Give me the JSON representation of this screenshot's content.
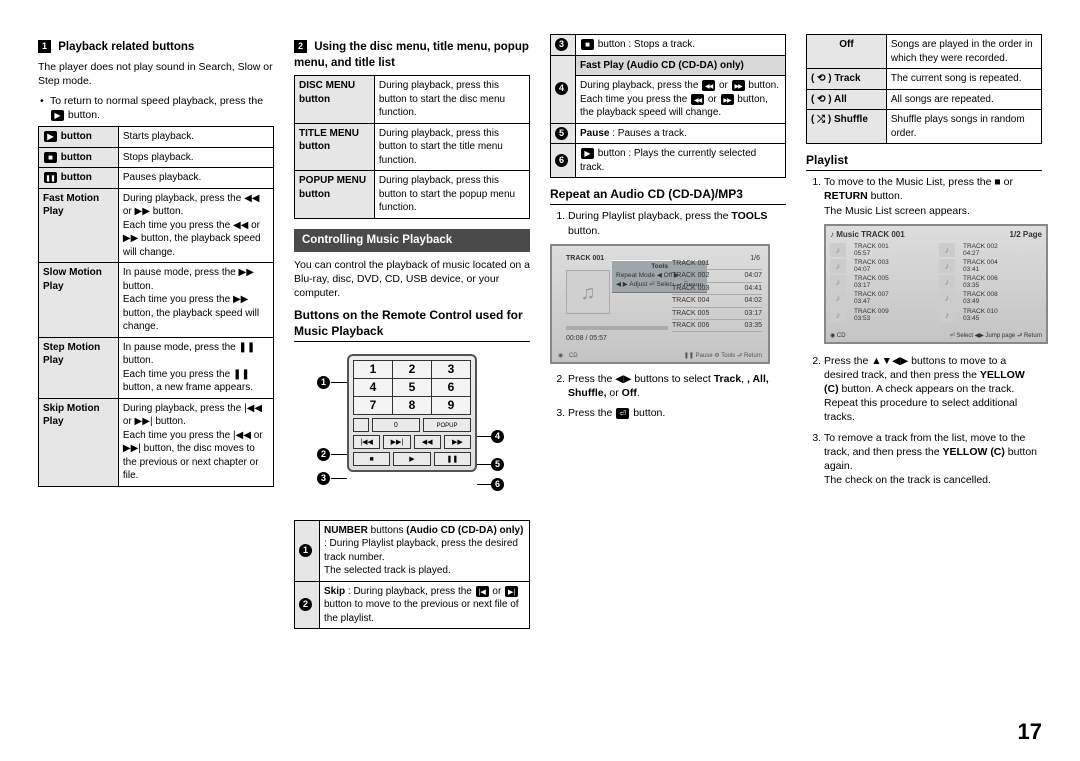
{
  "pageNumber": "17",
  "col1": {
    "h1": "Playback related buttons",
    "sqnum1": "1",
    "p1": "The player does not play sound in Search, Slow or Step mode.",
    "bullet1a": "To return to normal speed playback, press the ",
    "bullet1b": " button.",
    "tbl": {
      "r1": {
        "k": " button",
        "v": "Starts playback."
      },
      "r2": {
        "k": " button",
        "v": "Stops playback."
      },
      "r3": {
        "k": " button",
        "v": "Pauses playback."
      },
      "r4k": "Fast Motion Play",
      "r4v": "During playback, press the ◀◀ or ▶▶ button.\nEach time you press the ◀◀ or ▶▶ button, the playback speed will change.",
      "r5k": "Slow Motion Play",
      "r5v": "In pause mode, press the ▶▶ button.\nEach time you press the ▶▶ button, the playback speed will change.",
      "r6k": "Step Motion Play",
      "r6v": "In pause mode, press the ❚❚ button.\nEach time you press the ❚❚ button, a new frame appears.",
      "r7k": "Skip Motion Play",
      "r7v": "During playback, press the |◀◀ or ▶▶| button.\nEach time you press the |◀◀ or ▶▶| button, the disc moves to the previous or next chapter or file."
    }
  },
  "col2": {
    "sqnum2": "2",
    "h2a": "Using the disc menu, title menu, popup menu, and title list",
    "tbl2": {
      "r1k": "DISC MENU button",
      "r1v": "During playback, press this button to start the disc menu function.",
      "r2k": "TITLE MENU button",
      "r2v": "During playback, press this button to start the title menu function.",
      "r3k": "POPUP MENU button",
      "r3v": "During playback, press this button to start the popup menu function."
    },
    "hblack": "Controlling Music Playback",
    "p1": "You can control the playback of music located on a Blu-ray, disc, DVD, CD, USB device, or your computer.",
    "hb2": "Buttons on the Remote Control used for Music Playback",
    "remote": {
      "row0": {
        "a": "0",
        "b": "POPUP"
      },
      "rowT1": {
        "a": "|◀◀",
        "b": "▶▶|",
        "c": "◀◀",
        "d": "▶▶"
      },
      "rowT2": {
        "a": "■",
        "b": "▶",
        "c": "❚❚"
      }
    },
    "nums": {
      "n1": "1",
      "n2": "2",
      "n3": "3",
      "n4": "4",
      "n5": "5",
      "n6": "6"
    },
    "tbl3": {
      "r1n": "1",
      "r1v": "NUMBER buttons (Audio CD (CD-DA) only) : During Playlist playback, press the desired track number.\nThe selected track is played.",
      "r2n": "2",
      "r2v": "Skip : During playback, press the |◀◀ or ▶▶| button to move to the previous or next file of the playlist."
    }
  },
  "col3": {
    "tbl3b": {
      "r3n": "3",
      "r3v": "■ button : Stops a track.",
      "r4n": "4",
      "r4head": "Fast Play (Audio CD (CD-DA) only)",
      "r4v": "During playback, press the ◀◀ or ▶▶ button.\nEach time you press the ◀◀ or ▶▶ button, the playback speed will change.",
      "r5n": "5",
      "r5v": "Pause : Pauses a track.",
      "r6n": "6",
      "r6v": "▶ button : Plays the currently selected track."
    },
    "hrep": "Repeat an Audio CD (CD-DA)/MP3",
    "step1a": "During Playlist playback, press the ",
    "step1b": "TOOLS",
    "step1c": " button.",
    "step2a": "Press the ◀▶ buttons to select ",
    "step2b": "Track",
    "step2c": ", All, Shuffle,",
    "step2d": " or ",
    "step2e": "Off",
    "step2f": ".",
    "step3a": "Press the ",
    "step3b": " button.",
    "mock": {
      "title": "TRACK 001",
      "count": "1/6",
      "tools": "Tools",
      "repmode": "Repeat Mode    ◀   Off   ▶",
      "adj": "◀ ▶ Adjust   ⏎ Select   ⮐ Return",
      "t1": "TRACK 001",
      "t2": "TRACK 002",
      "t3": "TRACK 003",
      "t4": "TRACK 004",
      "t5": "TRACK 005",
      "t6": "TRACK 006",
      "d2": "04:07",
      "d3": "04:41",
      "d4": "04:02",
      "d5": "03:17",
      "d6": "03:35",
      "time": "00:08 / 05:57",
      "cd": "CD",
      "btm": "❚❚ Pause   ⚙ Tools   ⮐ Return"
    }
  },
  "col4": {
    "tbl4": {
      "r1k": "Off",
      "r1v": "Songs are played in the order in which they were recorded.",
      "r2k": "( ⟲ ) Track",
      "r2v": "The current song is repeated.",
      "r3k": "( ⟲ ) All",
      "r3v": "All songs are repeated.",
      "r4k": "( ⤮ ) Shuffle",
      "r4v": "Shuffle plays songs in random order."
    },
    "hpl": "Playlist",
    "s1a": "To move to the Music List, press the ■ or ",
    "s1b": "RETURN",
    "s1c": " button.",
    "s1d": "The Music List screen appears.",
    "mock2": {
      "hdr": "♪ Music   TRACK 001",
      "page": "1/2 Page",
      "rows": [
        {
          "t": "TRACK 001",
          "d": "05:57"
        },
        {
          "t": "TRACK 002",
          "d": "04:27"
        },
        {
          "t": "TRACK 003",
          "d": "04:07"
        },
        {
          "t": "TRACK 004",
          "d": "03:41"
        },
        {
          "t": "TRACK 005",
          "d": "03:17"
        },
        {
          "t": "TRACK 006",
          "d": "03:35"
        },
        {
          "t": "TRACK 007",
          "d": "03:47"
        },
        {
          "t": "TRACK 008",
          "d": "03:49"
        },
        {
          "t": "TRACK 009",
          "d": "03:53"
        },
        {
          "t": "TRACK 010",
          "d": "03:45"
        }
      ],
      "cd": "CD",
      "btm": "⏎ Select   ◀▶ Jump page   ⮐ Return"
    },
    "s2": "Press the ▲▼◀▶ buttons to move to a desired track, and then press the YELLOW (C) button. A check appears on the track.\nRepeat this procedure to select additional tracks.",
    "s2b1": "YELLOW (C)",
    "s3": "To remove a track from the list, move to the track, and then press the YELLOW (C) button again.\nThe check on the track is cancelled.",
    "s3b1": "YELLOW (C)"
  }
}
